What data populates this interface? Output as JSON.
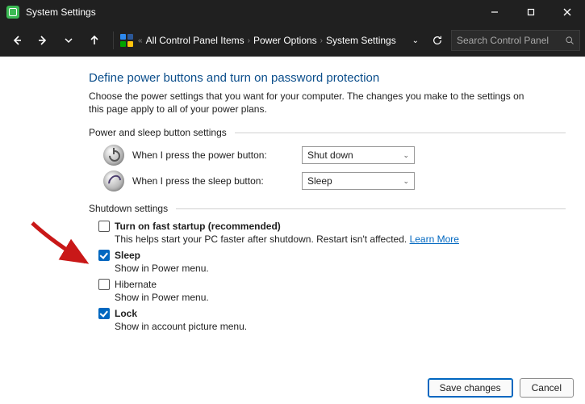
{
  "window": {
    "title": "System Settings"
  },
  "breadcrumb": {
    "prefix": "«",
    "items": [
      "All Control Panel Items",
      "Power Options",
      "System Settings"
    ]
  },
  "search": {
    "placeholder": "Search Control Panel"
  },
  "page": {
    "heading": "Define power buttons and turn on password protection",
    "description": "Choose the power settings that you want for your computer. The changes you make to the settings on this page apply to all of your power plans."
  },
  "sections": {
    "buttons": {
      "title": "Power and sleep button settings",
      "power_label": "When I press the power button:",
      "power_value": "Shut down",
      "sleep_label": "When I press the sleep button:",
      "sleep_value": "Sleep"
    },
    "shutdown": {
      "title": "Shutdown settings",
      "items": [
        {
          "label": "Turn on fast startup (recommended)",
          "bold": true,
          "checked": false,
          "sub": "This helps start your PC faster after shutdown. Restart isn't affected.",
          "link": "Learn More"
        },
        {
          "label": "Sleep",
          "bold": true,
          "checked": true,
          "sub": "Show in Power menu."
        },
        {
          "label": "Hibernate",
          "bold": false,
          "checked": false,
          "sub": "Show in Power menu."
        },
        {
          "label": "Lock",
          "bold": true,
          "checked": true,
          "sub": "Show in account picture menu."
        }
      ]
    }
  },
  "footer": {
    "save": "Save changes",
    "cancel": "Cancel"
  }
}
